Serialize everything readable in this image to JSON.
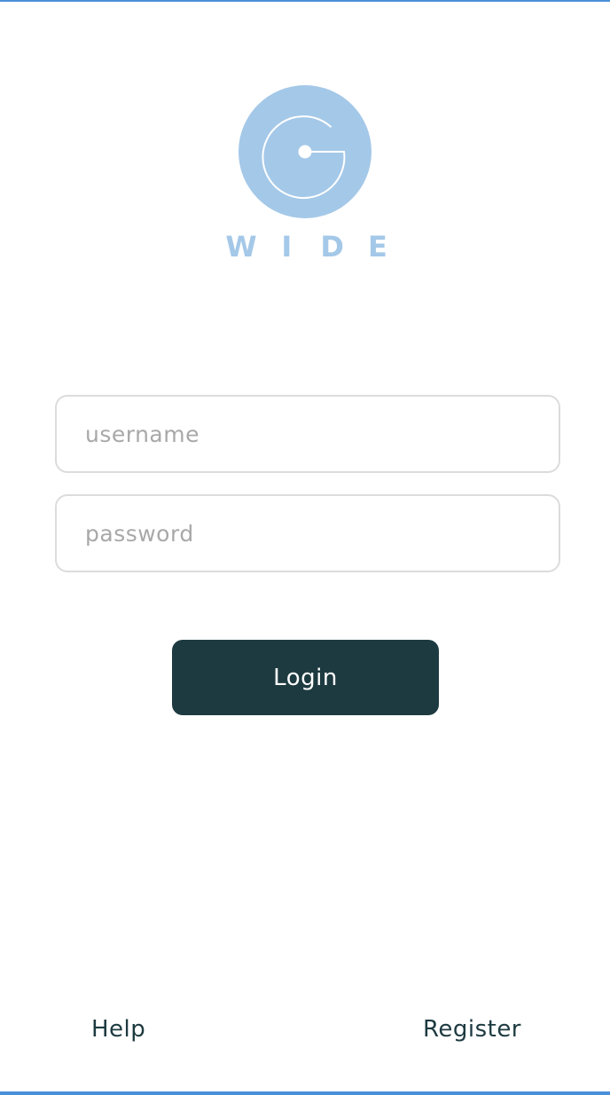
{
  "logo": {
    "letters": [
      "W",
      "I",
      "D",
      "E"
    ],
    "color": "#a4c8e8",
    "icon": "g-circle-logo-icon"
  },
  "form": {
    "username_placeholder": "username",
    "password_placeholder": "password",
    "username_value": "",
    "password_value": ""
  },
  "actions": {
    "login_label": "Login",
    "help_label": "Help",
    "register_label": "Register"
  },
  "colors": {
    "primary": "#1d3a40",
    "accent": "#a4c8e8",
    "border": "#4a90d9"
  }
}
